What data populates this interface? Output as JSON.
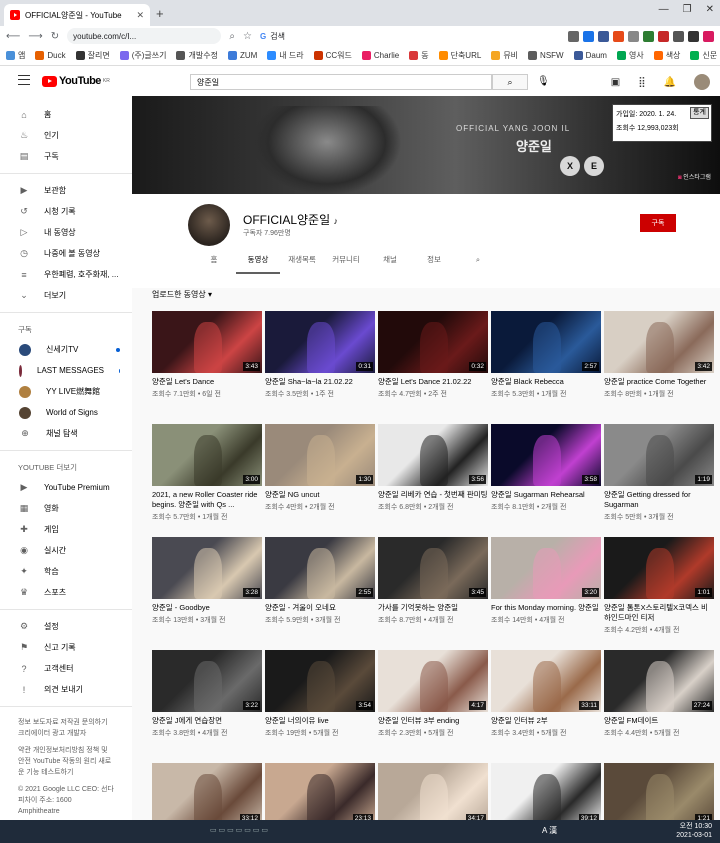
{
  "browser": {
    "tab_title": "OFFICIAL양준일 - YouTube",
    "url": "youtube.com/c/I...",
    "omnibox_search": "검색",
    "bookmarks": [
      "앱",
      "Duck",
      "잘리면",
      "(주)글쓰기",
      "개발수정",
      "ZUM",
      "내 드라",
      "CC워드",
      "Charlie",
      "동",
      "단축URL",
      "뮤비",
      "NSFW",
      "Daum",
      "영사",
      "색상",
      "신문"
    ],
    "bookmark_colors": [
      "#4a90d9",
      "#e66000",
      "#333333",
      "#7b68ee",
      "#555555",
      "#3d7bd9",
      "#2d8cff",
      "#cc3300",
      "#e91e63",
      "#d9383a",
      "#ff8c00",
      "#f5a623",
      "#5c5c5c",
      "#3b5998",
      "#00a651",
      "#ff6600",
      "#00b050"
    ]
  },
  "header": {
    "logo_text": "YouTube",
    "logo_region": "KR",
    "search_value": "양준일"
  },
  "sidebar": {
    "main": [
      {
        "label": "홈",
        "icon": "home-icon",
        "glyph": "⌂"
      },
      {
        "label": "인기",
        "icon": "flame-icon",
        "glyph": "♨"
      },
      {
        "label": "구독",
        "icon": "subscriptions-icon",
        "glyph": "▤"
      }
    ],
    "library": [
      {
        "label": "보관함",
        "icon": "library-icon",
        "glyph": "▶"
      },
      {
        "label": "시청 기록",
        "icon": "history-icon",
        "glyph": "↺"
      },
      {
        "label": "내 동영상",
        "icon": "my-videos-icon",
        "glyph": "▷"
      },
      {
        "label": "나중에 볼 동영상",
        "icon": "clock-icon",
        "glyph": "◷"
      },
      {
        "label": "우한폐렴, 호주화재, ...",
        "icon": "playlist-icon",
        "glyph": "≡"
      },
      {
        "label": "더보기",
        "icon": "chevron-down-icon",
        "glyph": "⌄"
      }
    ],
    "subs_header": "구독",
    "subscriptions": [
      {
        "label": "신세기TV",
        "color": "#2a4a7a",
        "dot": true
      },
      {
        "label": "LAST MESSAGES",
        "color": "#7a2a3a",
        "dot": true
      },
      {
        "label": "YY LIVE燃舞館",
        "color": "#b08040",
        "dot": false
      },
      {
        "label": "World of Signs",
        "color": "#554433",
        "dot": false
      },
      {
        "label": "채널 탐색",
        "color": "",
        "dot": false
      }
    ],
    "more_header": "YOUTUBE 더보기",
    "more": [
      {
        "label": "YouTube Premium",
        "icon": "premium-icon",
        "glyph": "▶"
      },
      {
        "label": "영화",
        "icon": "movie-icon",
        "glyph": "▦"
      },
      {
        "label": "게임",
        "icon": "game-icon",
        "glyph": "✚"
      },
      {
        "label": "실시간",
        "icon": "live-icon",
        "glyph": "◉"
      },
      {
        "label": "학습",
        "icon": "learning-icon",
        "glyph": "✦"
      },
      {
        "label": "스포츠",
        "icon": "trophy-icon",
        "glyph": "♛"
      }
    ],
    "settings": [
      {
        "label": "설정",
        "icon": "gear-icon",
        "glyph": "⚙"
      },
      {
        "label": "신고 기록",
        "icon": "flag-icon",
        "glyph": "⚑"
      },
      {
        "label": "고객센터",
        "icon": "help-icon",
        "glyph": "?"
      },
      {
        "label": "의견 보내기",
        "icon": "feedback-icon",
        "glyph": "!"
      }
    ],
    "footer": [
      "정보 보도자료 저작권 문의하기 크리에이터 광고 개발자",
      "약관 개인정보처리방침 정책 및 안전 YouTube 작동의 원리 새로운 기능 테스트하기",
      "© 2021 Google LLC CEO: 선다 피차이 주소: 1600 Amphitheatre"
    ]
  },
  "banner": {
    "subtitle": "OFFICIAL YANG JOON IL",
    "name": "양준일",
    "logo_a": "X",
    "logo_b": "E",
    "join_date": "가입일: 2020. 1. 24.",
    "join_btn": "통계",
    "views": "조회수 12,993,023회",
    "insta": "인스타그램"
  },
  "channel": {
    "name": "OFFICIAL양준일",
    "note": "♪",
    "subscribers": "구독자 7.96만명",
    "subscribe_label": "구독",
    "tabs": [
      "홈",
      "동영상",
      "재생목록",
      "커뮤니티",
      "채널",
      "정보"
    ],
    "active_tab": 1,
    "sort_label": "업로드한 동영상"
  },
  "videos": [
    {
      "title": "양준일 Let's Dance",
      "views": "조회수 7.1만회",
      "age": "6일 전",
      "dur": "3:43",
      "bg": "#3a1518",
      "fg": "#c44"
    },
    {
      "title": "양준일 Sha~la~la 21.02.22",
      "views": "조회수 3.5만회",
      "age": "1주 전",
      "dur": "0:31",
      "bg": "#1a1a3a",
      "fg": "#6a4ad0"
    },
    {
      "title": "양준일 Let's Dance 21.02.22",
      "views": "조회수 4.7만회",
      "age": "2주 전",
      "dur": "0:32",
      "bg": "#220a0a",
      "fg": "#6a1a1a"
    },
    {
      "title": "양준일 Black Rebecca",
      "views": "조회수 5.3만회",
      "age": "1개월 전",
      "dur": "2:57",
      "bg": "#0a1a3a",
      "fg": "#2a5a9a"
    },
    {
      "title": "양준일 practice Come Together",
      "views": "조회수 8만회",
      "age": "1개월 전",
      "dur": "3:42",
      "bg": "#d8cfc4",
      "fg": "#8a6a5a"
    },
    {
      "title": "2021, a new Roller Coaster ride begins. 양준일 with Qs ...",
      "views": "조회수 5.7만회",
      "age": "1개월 전",
      "dur": "3:00",
      "bg": "#8a9078",
      "fg": "#3a3a2a"
    },
    {
      "title": "양준일 NG uncut",
      "views": "조회수 4만회",
      "age": "2개월 전",
      "dur": "1:30",
      "bg": "#9a8a7a",
      "fg": "#c8b090"
    },
    {
      "title": "양준일 리베카 연습 - 첫번째 판미팅",
      "views": "조회수 6.8만회",
      "age": "2개월 전",
      "dur": "3:56",
      "bg": "#e8e8e8",
      "fg": "#222222"
    },
    {
      "title": "양준일 Sugarman Rehearsal",
      "views": "조회수 8.1만회",
      "age": "2개월 전",
      "dur": "3:58",
      "bg": "#0a0a2a",
      "fg": "#c040d0"
    },
    {
      "title": "양준일 Getting dressed for Sugarman",
      "views": "조회수 5만회",
      "age": "3개월 전",
      "dur": "1:19",
      "bg": "#8a8a8a",
      "fg": "#4a4a4a"
    },
    {
      "title": "양준일 - Goodbye",
      "views": "조회수 13만회",
      "age": "3개월 전",
      "dur": "3:28",
      "bg": "#4a4a52",
      "fg": "#d8c8b0"
    },
    {
      "title": "양준일 - 겨울이 오네요",
      "views": "조회수 5.9만회",
      "age": "3개월 전",
      "dur": "2:55",
      "bg": "#3a3a42",
      "fg": "#c8b8a0"
    },
    {
      "title": "가사를 기억못하는 양준일",
      "views": "조회수 8.7만회",
      "age": "4개월 전",
      "dur": "3:45",
      "bg": "#2a2a2a",
      "fg": "#7a6a5a"
    },
    {
      "title": "For this Monday morning. 양준일",
      "views": "조회수 14만회",
      "age": "4개월 전",
      "dur": "3:20",
      "bg": "#b8b0a8",
      "fg": "#e89ab8"
    },
    {
      "title": "양준일 톰톤X스토리텔X코덱스 비하인드마인 티저",
      "views": "조회수 4.2만회",
      "age": "4개월 전",
      "dur": "1:01",
      "bg": "#1a1a1a",
      "fg": "#b03a2a"
    },
    {
      "title": "양준일 J에게 연습장면",
      "views": "조회수 3.8만회",
      "age": "4개월 전",
      "dur": "3:22",
      "bg": "#2a2a2a",
      "fg": "#6a6a6a"
    },
    {
      "title": "양준일 너의이유 live",
      "views": "조회수 19만회",
      "age": "5개월 전",
      "dur": "3:54",
      "bg": "#1a1a1a",
      "fg": "#5a4a3a"
    },
    {
      "title": "양준일 인터뷰 3부 ending",
      "views": "조회수 2.3만회",
      "age": "5개월 전",
      "dur": "4:17",
      "bg": "#e8e0d8",
      "fg": "#8a5a4a"
    },
    {
      "title": "양준일 인터뷰 2부",
      "views": "조회수 3.4만회",
      "age": "5개월 전",
      "dur": "33:11",
      "bg": "#e8e0d8",
      "fg": "#9a6a4a"
    },
    {
      "title": "양준일 FM데이트",
      "views": "조회수 4.4만회",
      "age": "5개월 전",
      "dur": "27:24",
      "bg": "#2a2a2a",
      "fg": "#d8d0c8"
    },
    {
      "title": "",
      "views": "",
      "age": "",
      "dur": "33:12",
      "bg": "#c8b8a8",
      "fg": "#6a4a3a"
    },
    {
      "title": "",
      "views": "",
      "age": "",
      "dur": "23:13",
      "bg": "#c8a890",
      "fg": "#3a2a2a"
    },
    {
      "title": "",
      "views": "",
      "age": "",
      "dur": "34:17",
      "bg": "#b8a898",
      "fg": "#f0e0d0"
    },
    {
      "title": "",
      "views": "",
      "age": "",
      "dur": "39:12",
      "bg": "#f0f0f0",
      "fg": "#2a2a2a"
    },
    {
      "title": "",
      "views": "",
      "age": "",
      "dur": "1:21",
      "bg": "#5a4a3a",
      "fg": "#9a8a6a"
    }
  ],
  "taskbar": {
    "time": "오전 10:30",
    "date": "2021-03-01",
    "ime": "A 漢"
  }
}
